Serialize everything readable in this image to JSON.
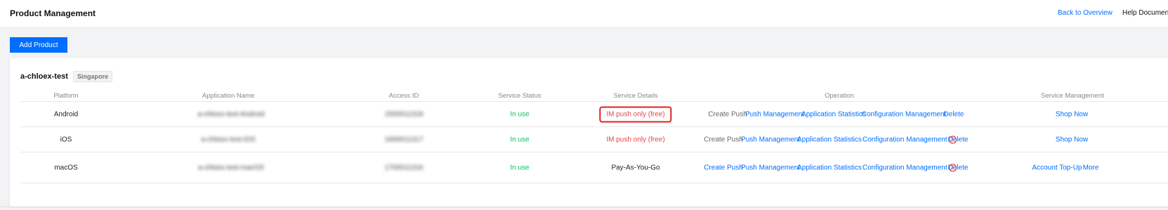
{
  "header": {
    "title": "Product Management",
    "back_link": "Back to Overview",
    "help_link": "Help Document"
  },
  "toolbar": {
    "add_label": "Add Product"
  },
  "product": {
    "name": "a-chloex-test",
    "region": "Singapore"
  },
  "table": {
    "columns": [
      "Platform",
      "Application Name",
      "Access ID",
      "Service Status",
      "Service Details",
      "Operation",
      "Service Management"
    ],
    "rows": [
      {
        "platform": "Android",
        "app_name": "a-chloex-test-Android",
        "access_id": "1500011318",
        "status": "In use",
        "details": "IM push only (free)",
        "ops": {
          "create_push": "Create Push",
          "push_mgmt": "Push Management",
          "app_stats": "Application Statistics",
          "config_mgmt": "Configuration Management",
          "delete": "Delete"
        },
        "service": {
          "shop": "Shop Now"
        }
      },
      {
        "platform": "iOS",
        "app_name": "a-chloex-test-iOS",
        "access_id": "1600011317",
        "status": "In use",
        "details": "IM push only (free)",
        "ops": {
          "create_push": "Create Push",
          "push_mgmt": "Push Management",
          "app_stats": "Application Statistics",
          "config_mgmt": "Configuration Management",
          "delete": "Delete"
        },
        "service": {
          "shop": "Shop Now"
        }
      },
      {
        "platform": "macOS",
        "app_name": "a-chloex-test-macOS",
        "access_id": "1700011316",
        "status": "In use",
        "details": "Pay-As-You-Go",
        "ops": {
          "create_push": "Create Push",
          "push_mgmt": "Push Management",
          "app_stats": "Application Statistics",
          "config_mgmt": "Configuration Management",
          "delete": "Delete"
        },
        "service": {
          "topup": "Account Top-Up",
          "more": "More"
        }
      }
    ]
  },
  "icons": {
    "warning": "exclamation-circle-icon"
  },
  "colors": {
    "accent": "#006eff",
    "status_ok": "#0abf5b",
    "alert": "#e54545"
  }
}
